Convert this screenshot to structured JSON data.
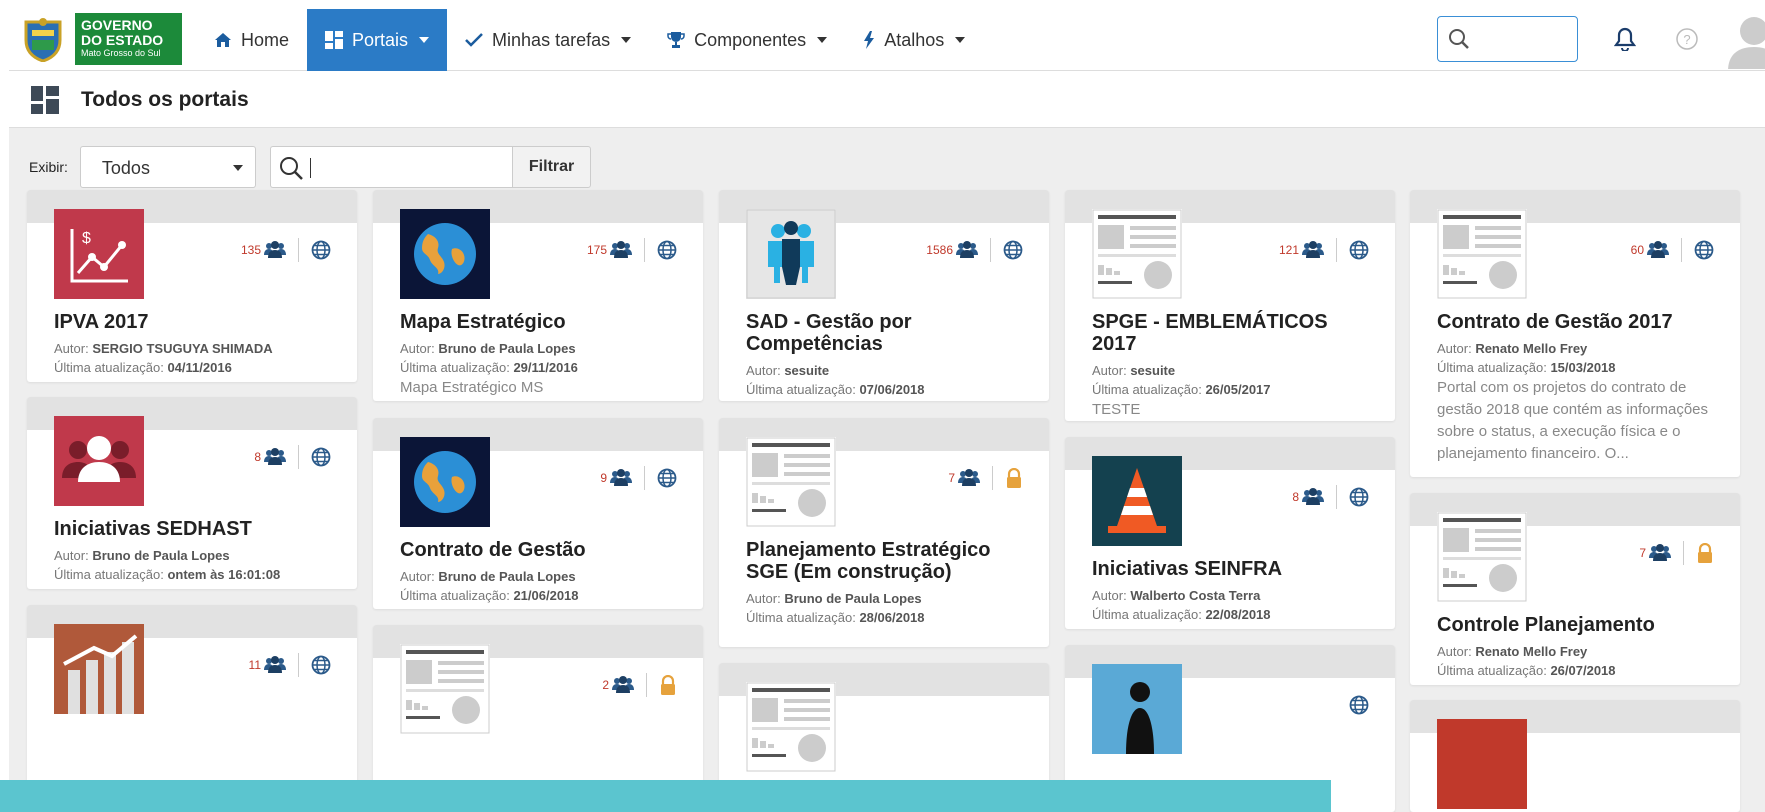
{
  "brand": {
    "line1": "GOVERNO",
    "line2": "DO ESTADO",
    "line3": "Mato Grosso do Sul"
  },
  "nav": [
    {
      "label": "Home",
      "icon": "home-icon",
      "active": false,
      "dropdown": false
    },
    {
      "label": "Portais",
      "icon": "grid-icon",
      "active": true,
      "dropdown": true
    },
    {
      "label": "Minhas tarefas",
      "icon": "check-icon",
      "active": false,
      "dropdown": true
    },
    {
      "label": "Componentes",
      "icon": "trophy-icon",
      "active": false,
      "dropdown": true
    },
    {
      "label": "Atalhos",
      "icon": "bolt-icon",
      "active": false,
      "dropdown": true
    }
  ],
  "page_title": "Todos os portais",
  "filters": {
    "show_label": "Exibir:",
    "show_value": "Todos",
    "search_value": "",
    "filter_button": "Filtrar"
  },
  "colors": {
    "accent": "#2b7bc6",
    "brand_green": "#1c8a3a",
    "count_red": "#c0392b",
    "lock_orange": "#e6a23c",
    "bottom_bar": "#5bc5cf"
  },
  "cards": [
    {
      "title": "IPVA 2017",
      "author_label": "Autor:",
      "author": "SERGIO TSUGUYA SHIMADA",
      "updated_label": "Última atualização:",
      "updated": "04/11/2016",
      "desc": "",
      "count": "135",
      "access": "public",
      "thumb": "chart"
    },
    {
      "title": "Mapa Estratégico",
      "author_label": "Autor:",
      "author": "Bruno de Paula Lopes",
      "updated_label": "Última atualização:",
      "updated": "29/11/2016",
      "desc": "Mapa Estratégico MS",
      "count": "175",
      "access": "public",
      "thumb": "globe"
    },
    {
      "title": "SAD - Gestão por Competências",
      "author_label": "Autor:",
      "author": "sesuite",
      "updated_label": "Última atualização:",
      "updated": "07/06/2018",
      "desc": "",
      "count": "1586",
      "access": "public",
      "thumb": "team"
    },
    {
      "title": "SPGE - EMBLEMÁTICOS 2017",
      "author_label": "Autor:",
      "author": "sesuite",
      "updated_label": "Última atualização:",
      "updated": "26/05/2017",
      "desc": "TESTE",
      "count": "121",
      "access": "public",
      "thumb": "doc"
    },
    {
      "title": "Contrato de Gestão 2017",
      "author_label": "Autor:",
      "author": "Renato Mello Frey",
      "updated_label": "Última atualização:",
      "updated": "15/03/2018",
      "desc": "Portal com os projetos do contrato de gestão 2018 que contém as informações sobre o status, a execução física e o planejamento financeiro. O...",
      "count": "60",
      "access": "public",
      "thumb": "doc"
    },
    {
      "title": "Iniciativas SEDHAST",
      "author_label": "Autor:",
      "author": "Bruno de Paula Lopes",
      "updated_label": "Última atualização:",
      "updated": "ontem às 16:01:08",
      "desc": "",
      "count": "8",
      "access": "public",
      "thumb": "people"
    },
    {
      "title": "Contrato de Gestão",
      "author_label": "Autor:",
      "author": "Bruno de Paula Lopes",
      "updated_label": "Última atualização:",
      "updated": "21/06/2018",
      "desc": "",
      "count": "9",
      "access": "public",
      "thumb": "globe"
    },
    {
      "title": "Planejamento Estratégico SGE (Em construção)",
      "author_label": "Autor:",
      "author": "Bruno de Paula Lopes",
      "updated_label": "Última atualização:",
      "updated": "28/06/2018",
      "desc": "",
      "count": "7",
      "access": "private",
      "thumb": "doc"
    },
    {
      "title": "Iniciativas SEINFRA",
      "author_label": "Autor:",
      "author": "Walberto Costa Terra",
      "updated_label": "Última atualização:",
      "updated": "22/08/2018",
      "desc": "",
      "count": "8",
      "access": "public",
      "thumb": "cone"
    },
    {
      "title": "Controle Planejamento",
      "author_label": "Autor:",
      "author": "Renato Mello Frey",
      "updated_label": "Última atualização:",
      "updated": "26/07/2018",
      "desc": "",
      "count": "7",
      "access": "private",
      "thumb": "doc"
    },
    {
      "title": "",
      "author_label": "",
      "author": "",
      "updated_label": "",
      "updated": "",
      "desc": "",
      "count": "11",
      "access": "public",
      "thumb": "bars"
    },
    {
      "title": "",
      "author_label": "",
      "author": "",
      "updated_label": "",
      "updated": "",
      "desc": "",
      "count": "2",
      "access": "private",
      "thumb": "doc"
    },
    {
      "title": "",
      "author_label": "",
      "author": "",
      "updated_label": "",
      "updated": "",
      "desc": "",
      "count": "",
      "access": "none",
      "thumb": "doc"
    },
    {
      "title": "",
      "author_label": "",
      "author": "",
      "updated_label": "",
      "updated": "",
      "desc": "",
      "count": "",
      "access": "public",
      "thumb": "person"
    },
    {
      "title": "",
      "author_label": "",
      "author": "",
      "updated_label": "",
      "updated": "",
      "desc": "",
      "count": "",
      "access": "none",
      "thumb": "red"
    }
  ]
}
